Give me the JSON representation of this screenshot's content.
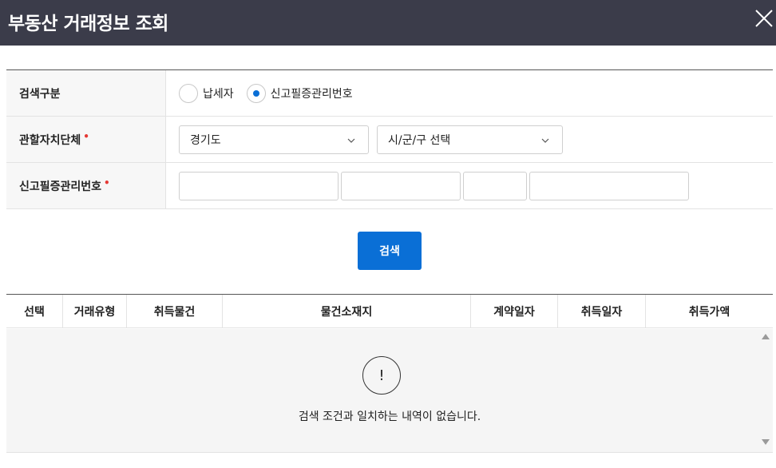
{
  "header": {
    "title": "부동산 거래정보 조회",
    "close_icon": "close-icon"
  },
  "form": {
    "search_type": {
      "label": "검색구분",
      "options": [
        {
          "label": "납세자",
          "checked": false
        },
        {
          "label": "신고필증관리번호",
          "checked": true
        }
      ]
    },
    "local_gov": {
      "label": "관할자치단체",
      "required_mark": "•",
      "province_value": "경기도",
      "city_value": "시/군/구 선택"
    },
    "report_no": {
      "label": "신고필증관리번호",
      "required_mark": "•",
      "inputs": [
        "",
        "",
        "",
        ""
      ]
    }
  },
  "search_button": {
    "label": "검색"
  },
  "table": {
    "columns": [
      "선택",
      "거래유형",
      "취득물건",
      "물건소재지",
      "계약일자",
      "취득일자",
      "취득가액"
    ],
    "rows": [],
    "empty_icon": "!",
    "empty_message": "검색 조건과 일치하는 내역이 없습니다."
  },
  "colors": {
    "header_bg": "#3b3c4a",
    "accent": "#0a6fd6",
    "required": "#e53935"
  }
}
